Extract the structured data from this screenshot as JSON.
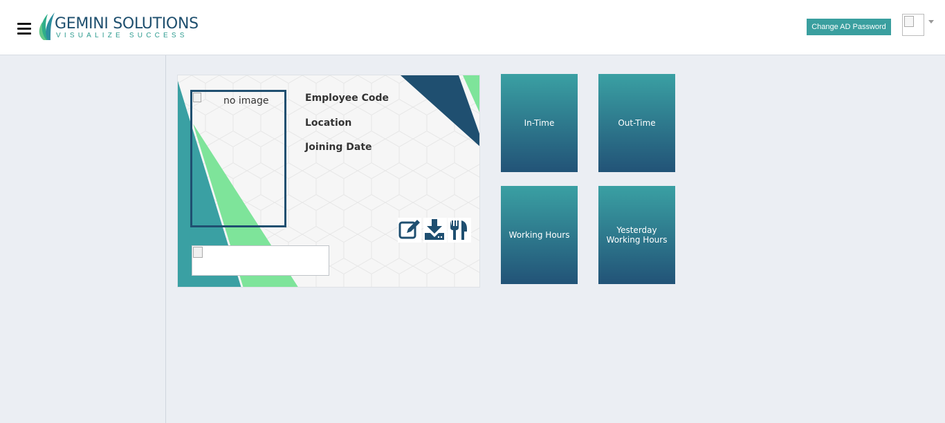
{
  "header": {
    "logo": {
      "brand": "GEMINI SOLUTIONS",
      "tagline": "VISUALIZE SUCCESS",
      "icon": "leaf-logo-icon"
    },
    "change_password_label": "Change AD Password",
    "menu_icon": "hamburger-menu-icon",
    "avatar_icon": "user-avatar-icon",
    "dropdown_icon": "caret-down-icon"
  },
  "profile_card": {
    "photo_alt": "no image",
    "fields": {
      "employee_code_label": "Employee Code",
      "location_label": "Location",
      "joining_date_label": "Joining Date"
    },
    "actions": [
      {
        "icon": "edit-icon"
      },
      {
        "icon": "download-icon"
      },
      {
        "icon": "cutlery-icon"
      }
    ]
  },
  "tiles": [
    {
      "label": "In-Time"
    },
    {
      "label": "Out-Time"
    },
    {
      "label": "Working Hours"
    },
    {
      "label": "Yesterday\nWorking Hours"
    }
  ],
  "colors": {
    "accent_teal": "#3a9f9f",
    "navy": "#1f4f70",
    "light_green": "#7ee49a",
    "tile_top": "#3aa0a3",
    "tile_bottom": "#225377"
  }
}
